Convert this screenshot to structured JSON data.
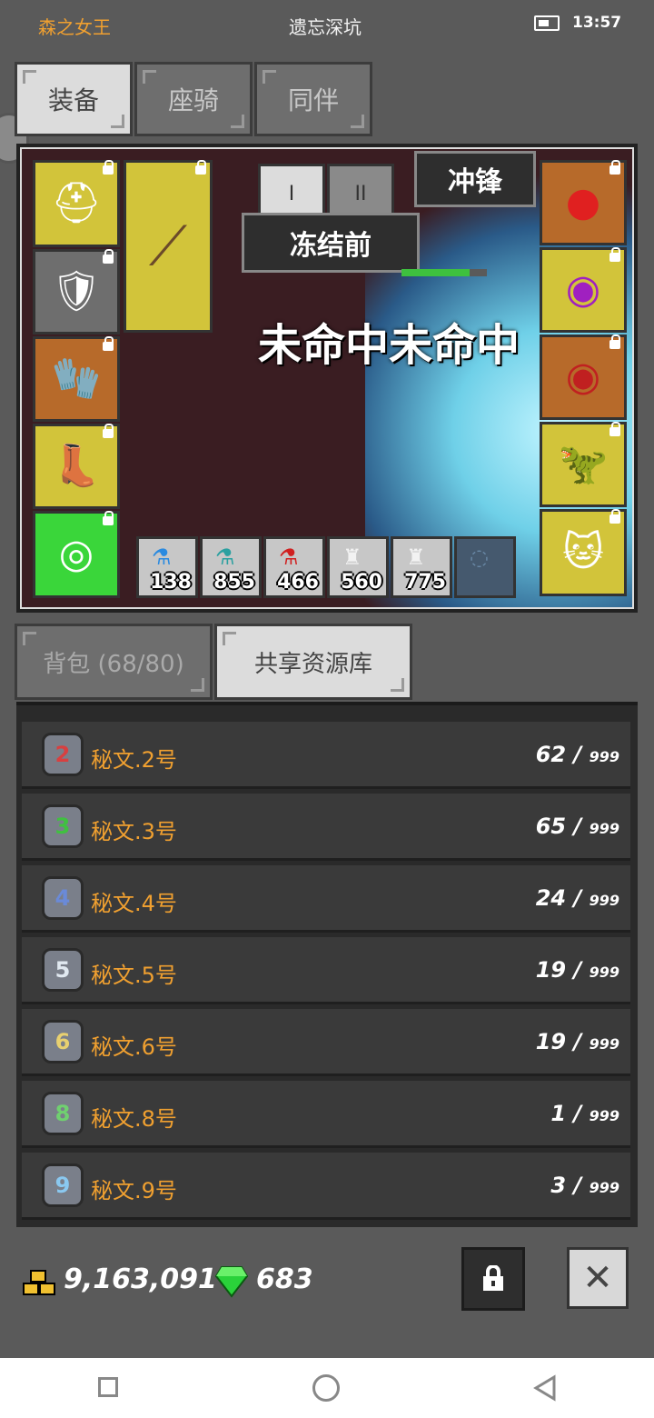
{
  "status": {
    "character": "森之女王",
    "location": "遗忘深坑",
    "time": "13:57"
  },
  "top_tabs": [
    {
      "label": "装备"
    },
    {
      "label": "座骑"
    },
    {
      "label": "同伴"
    }
  ],
  "scene": {
    "mode_buttons": [
      "I",
      "II"
    ],
    "skill_label": "冲锋",
    "effect_label": "冻结前",
    "miss_text": "未命中未命中",
    "left_slots": [
      {
        "icon": "helmet-icon",
        "color": "yellow"
      },
      {
        "icon": "armor-icon",
        "color": "gray"
      },
      {
        "icon": "glove-icon",
        "color": "orange"
      },
      {
        "icon": "boots-icon",
        "color": "yellow"
      },
      {
        "icon": "shield-icon",
        "color": "green"
      }
    ],
    "weapon_slot": {
      "icon": "bow-icon",
      "color": "yellow"
    },
    "right_slots": [
      {
        "icon": "red-amulet-icon",
        "color": "orange"
      },
      {
        "icon": "purple-ring-icon",
        "color": "yellow"
      },
      {
        "icon": "red-ring-icon",
        "color": "orange"
      },
      {
        "icon": "mount-icon",
        "color": "yellow"
      },
      {
        "icon": "cat-pet-icon",
        "color": "yellow"
      }
    ],
    "potions": [
      {
        "icon": "blue-potion-icon",
        "count": "138"
      },
      {
        "icon": "teal-potion-icon",
        "count": "855"
      },
      {
        "icon": "red-potion-icon",
        "count": "466"
      },
      {
        "icon": "mushroom-icon",
        "count": "560"
      },
      {
        "icon": "mushroom-icon",
        "count": "775"
      },
      {
        "icon": "empty-slot-icon",
        "count": ""
      }
    ]
  },
  "inventory_tabs": [
    {
      "label": "背包 (68/80)"
    },
    {
      "label": "共享资源库"
    }
  ],
  "items": [
    {
      "rune": "2",
      "name": "秘文.2号",
      "count": "62 /",
      "max": "999",
      "color": "#d84040"
    },
    {
      "rune": "3",
      "name": "秘文.3号",
      "count": "65 /",
      "max": "999",
      "color": "#40c040"
    },
    {
      "rune": "4",
      "name": "秘文.4号",
      "count": "24 /",
      "max": "999",
      "color": "#6a8ad8"
    },
    {
      "rune": "5",
      "name": "秘文.5号",
      "count": "19 /",
      "max": "999",
      "color": "#b0c4d8"
    },
    {
      "rune": "6",
      "name": "秘文.6号",
      "count": "19 /",
      "max": "999",
      "color": "#d8c060"
    },
    {
      "rune": "8",
      "name": "秘文.8号",
      "count": "1 /",
      "max": "999",
      "color": "#60c060"
    },
    {
      "rune": "9",
      "name": "秘文.9号",
      "count": "3 /",
      "max": "999",
      "color": "#7ab8e8"
    }
  ],
  "currency": {
    "gold": "9,163,091",
    "gems": "683"
  },
  "colors": {
    "accent": "#f0a030",
    "slot_yellow": "#d2c43a",
    "slot_orange": "#b76a2a",
    "slot_green": "#3ad63a"
  }
}
